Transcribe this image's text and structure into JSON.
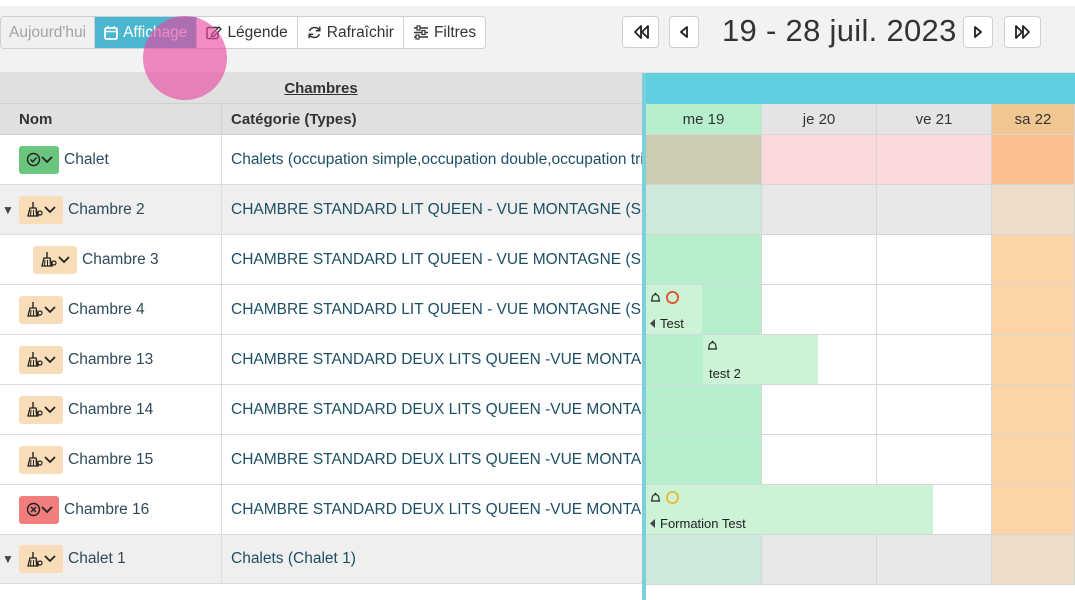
{
  "toolbar": {
    "today_label": "Aujourd'hui",
    "display_label": "Affichage",
    "legend_label": "Légende",
    "refresh_label": "Rafraîchir",
    "filters_label": "Filtres"
  },
  "nav": {
    "date_range": "19 - 28 juil. 2023"
  },
  "table": {
    "group_header": "Chambres",
    "col_name": "Nom",
    "col_category": "Catégorie (Types)"
  },
  "calendar": {
    "days": [
      "me 19",
      "je 20",
      "ve 21",
      "sa 22"
    ]
  },
  "rows": [
    {
      "name": "Chalet",
      "category": "Chalets (occupation simple,occupation double,occupation triple)",
      "status": "ok",
      "group": false,
      "expander": false
    },
    {
      "name": "Chambre 2",
      "category": "CHAMBRE STANDARD LIT QUEEN - VUE MONTAGNE (SIMPLE)",
      "status": "cleaning",
      "group": true,
      "expander": true
    },
    {
      "name": "Chambre 3",
      "category": "CHAMBRE STANDARD LIT QUEEN - VUE MONTAGNE (SIMPLE)",
      "status": "cleaning",
      "group": false,
      "expander": false
    },
    {
      "name": "Chambre 4",
      "category": "CHAMBRE STANDARD LIT QUEEN - VUE MONTAGNE (SIMPLE)",
      "status": "cleaning",
      "group": false,
      "expander": false
    },
    {
      "name": "Chambre 13",
      "category": "CHAMBRE STANDARD DEUX LITS QUEEN -VUE MONTAGNE",
      "status": "cleaning",
      "group": false,
      "expander": false
    },
    {
      "name": "Chambre 14",
      "category": "CHAMBRE STANDARD DEUX LITS QUEEN -VUE MONTAGNE",
      "status": "cleaning",
      "group": false,
      "expander": false
    },
    {
      "name": "Chambre 15",
      "category": "CHAMBRE STANDARD DEUX LITS QUEEN -VUE MONTAGNE",
      "status": "cleaning",
      "group": false,
      "expander": false
    },
    {
      "name": "Chambre 16",
      "category": "CHAMBRE STANDARD DEUX LITS QUEEN -VUE MONTAGNE",
      "status": "blocked",
      "group": false,
      "expander": false
    },
    {
      "name": "Chalet 1",
      "category": "Chalets (Chalet 1)",
      "status": "cleaning",
      "group": true,
      "expander": true
    }
  ],
  "events": [
    {
      "label": "Test",
      "circle_color": "#d9502c"
    },
    {
      "label": "test 2",
      "circle_color": ""
    },
    {
      "label": "Formation Test",
      "circle_color": "#e8b830"
    }
  ],
  "colors": {
    "accent": "#4ab6cf",
    "today_column": "#b6efcb",
    "weekend_column": "#fdd4a8",
    "event": "#cdf3d6",
    "status_ok": "#6cc57e",
    "status_cleaning": "#f9ddb8",
    "status_blocked": "#f27d7d"
  }
}
